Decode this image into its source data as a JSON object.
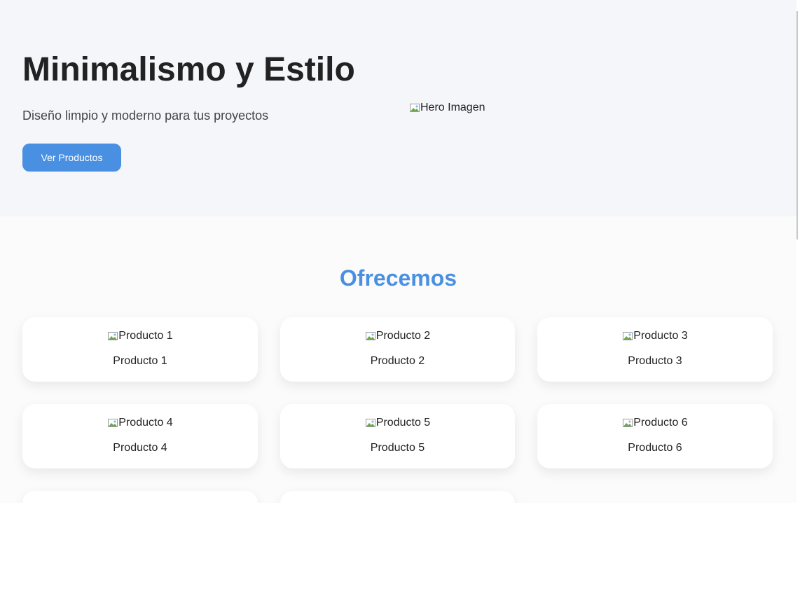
{
  "hero": {
    "title": "Minimalismo y Estilo",
    "subtitle": "Diseño limpio y moderno para tus proyectos",
    "button_label": "Ver Productos",
    "image_alt": "Hero Imagen"
  },
  "products": {
    "section_title": "Ofrecemos",
    "items": [
      {
        "image_alt": "Producto 1",
        "label": "Producto 1"
      },
      {
        "image_alt": "Producto 2",
        "label": "Producto 2"
      },
      {
        "image_alt": "Producto 3",
        "label": "Producto 3"
      },
      {
        "image_alt": "Producto 4",
        "label": "Producto 4"
      },
      {
        "image_alt": "Producto 5",
        "label": "Producto 5"
      },
      {
        "image_alt": "Producto 6",
        "label": "Producto 6"
      },
      {
        "image_alt": "",
        "label": ""
      },
      {
        "image_alt": "",
        "label": ""
      }
    ]
  },
  "colors": {
    "accent": "#4a90e2",
    "hero_background": "#f5f6fa",
    "section_background": "#fbfbfb",
    "card_background": "#ffffff",
    "text": "#222222"
  },
  "icons": {
    "broken_image": "broken-image-icon"
  }
}
